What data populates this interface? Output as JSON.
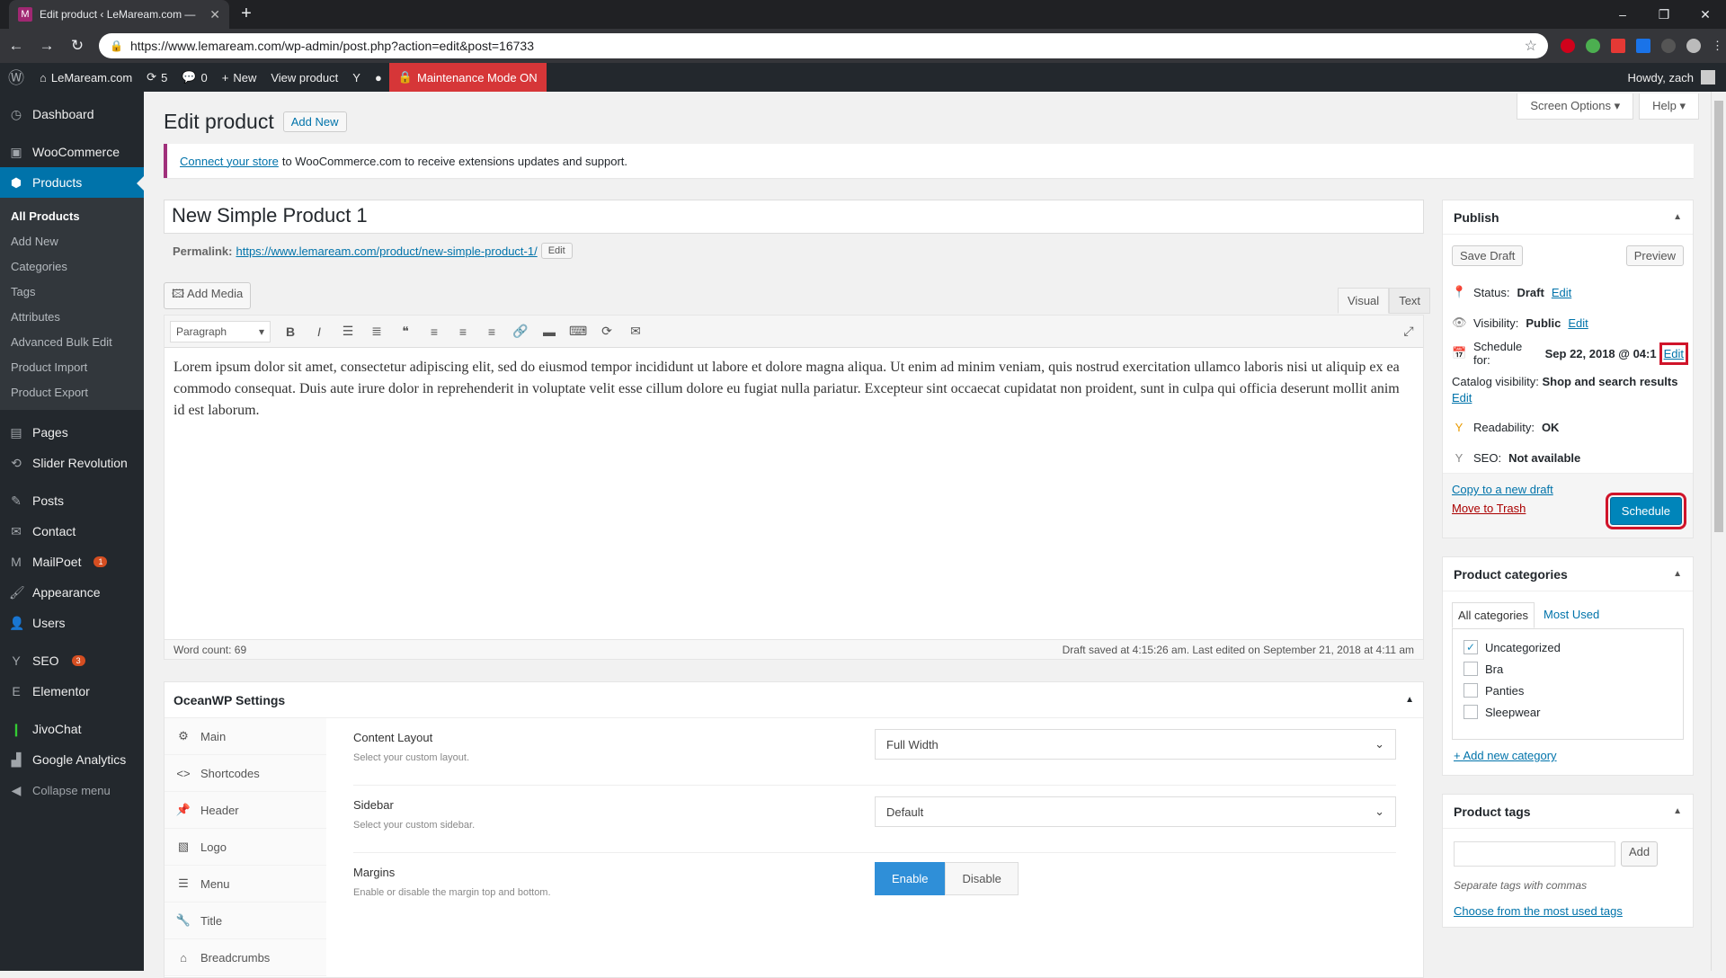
{
  "browser": {
    "tab_title": "Edit product ‹ LeMaream.com —",
    "favicon": "M",
    "url": "https://www.lemaream.com/wp-admin/post.php?action=edit&post=16733"
  },
  "adminbar": {
    "site": "LeMaream.com",
    "updates": "5",
    "comments": "0",
    "new": "New",
    "view": "View product",
    "maintenance": "Maintenance Mode ON",
    "howdy": "Howdy, zach"
  },
  "sidebar": {
    "dashboard": "Dashboard",
    "woocommerce": "WooCommerce",
    "products": "Products",
    "sub": [
      "All Products",
      "Add New",
      "Categories",
      "Tags",
      "Attributes",
      "Advanced Bulk Edit",
      "Product Import",
      "Product Export"
    ],
    "pages": "Pages",
    "slider": "Slider Revolution",
    "posts": "Posts",
    "contact": "Contact",
    "mailpoet": "MailPoet",
    "mailpoet_badge": "1",
    "appearance": "Appearance",
    "users": "Users",
    "seo": "SEO",
    "seo_badge": "3",
    "elementor": "Elementor",
    "jivochat": "JivoChat",
    "analytics": "Google Analytics",
    "collapse": "Collapse menu"
  },
  "header": {
    "screen_options": "Screen Options ▾",
    "help": "Help ▾",
    "title": "Edit product",
    "add_new": "Add New"
  },
  "notice": {
    "link": "Connect your store",
    "text": "to WooCommerce.com to receive extensions updates and support."
  },
  "post": {
    "title": "New Simple Product 1",
    "permalink_label": "Permalink:",
    "permalink": "https://www.lemaream.com/product/new-simple-product-1/",
    "edit": "Edit"
  },
  "editor": {
    "add_media": "Add Media",
    "tab_visual": "Visual",
    "tab_text": "Text",
    "format": "Paragraph",
    "content": "Lorem ipsum dolor sit amet, consectetur adipiscing elit, sed do eiusmod tempor incididunt ut labore et dolore magna aliqua. Ut enim ad minim veniam, quis nostrud exercitation ullamco laboris nisi ut aliquip ex ea commodo consequat. Duis aute irure dolor in reprehenderit in voluptate velit esse cillum dolore eu fugiat nulla pariatur. Excepteur sint occaecat cupidatat non proident, sunt in culpa qui officia deserunt mollit anim id est laborum.",
    "word_count": "Word count: 69",
    "saved": "Draft saved at 4:15:26 am. Last edited on September 21, 2018 at 4:11 am"
  },
  "ocean": {
    "title": "OceanWP Settings",
    "nav": [
      "Main",
      "Shortcodes",
      "Header",
      "Logo",
      "Menu",
      "Title",
      "Breadcrumbs"
    ],
    "content_layout": "Content Layout",
    "content_layout_desc": "Select your custom layout.",
    "content_layout_value": "Full Width",
    "sidebar": "Sidebar",
    "sidebar_desc": "Select your custom sidebar.",
    "sidebar_value": "Default",
    "margins": "Margins",
    "margins_desc": "Enable or disable the margin top and bottom.",
    "enable": "Enable",
    "disable": "Disable"
  },
  "publish": {
    "title": "Publish",
    "save_draft": "Save Draft",
    "preview": "Preview",
    "status_label": "Status:",
    "status": "Draft",
    "visibility_label": "Visibility:",
    "visibility": "Public",
    "schedule_label": "Schedule for:",
    "schedule": "Sep 22, 2018 @ 04:1",
    "edit": "Edit",
    "catalog_label": "Catalog visibility:",
    "catalog": "Shop and search results",
    "readability_label": "Readability:",
    "readability": "OK",
    "seo_label": "SEO:",
    "seo": "Not available",
    "copy": "Copy to a new draft",
    "trash": "Move to Trash",
    "schedule_btn": "Schedule"
  },
  "categories": {
    "title": "Product categories",
    "tab_all": "All categories",
    "tab_used": "Most Used",
    "items": [
      "Uncategorized",
      "Bra",
      "Panties",
      "Sleepwear"
    ],
    "add": "+ Add new category"
  },
  "tags": {
    "title": "Product tags",
    "add": "Add",
    "hint": "Separate tags with commas",
    "choose": "Choose from the most used tags"
  }
}
